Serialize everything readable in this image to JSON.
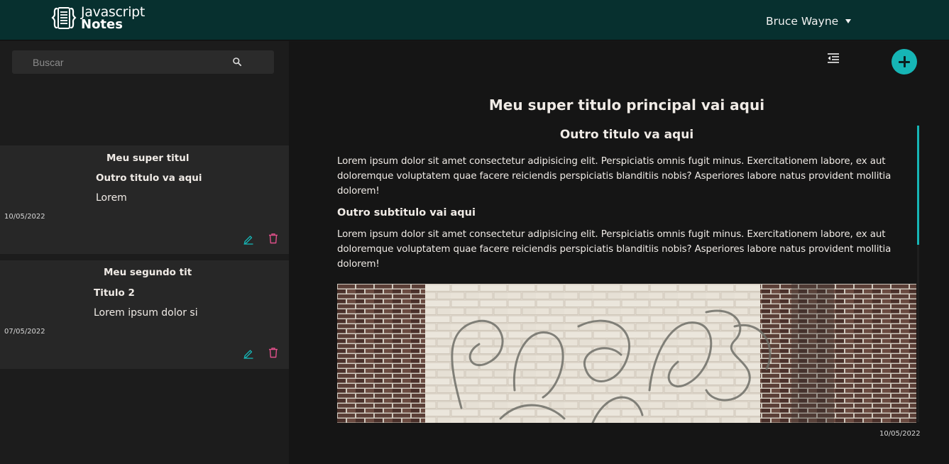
{
  "header": {
    "logo_line1": "Javascript",
    "logo_line2": "Notes",
    "user_name": "Bruce Wayne"
  },
  "search": {
    "placeholder": "Buscar",
    "value": ""
  },
  "notes": [
    {
      "title": "Meu super titul",
      "heading": "Outro titulo va aqui",
      "preview": "Lorem",
      "date": "10/05/2022"
    },
    {
      "title": "Meu segundo tit",
      "heading": "Titulo 2",
      "preview": "Lorem ipsum dolor si",
      "date": "07/05/2022"
    }
  ],
  "document": {
    "title": "Meu super titulo principal vai aqui",
    "heading2": "Outro titulo va aqui",
    "paragraph1": "Lorem ipsum dolor sit amet consectetur adipisicing elit. Perspiciatis omnis fugit minus. Exercitationem labore, ex aut doloremque voluptatem quae facere reiciendis perspiciatis blanditiis nobis? Asperiores labore natus provident mollitia dolorem!",
    "heading3": "Outro subtitulo vai aqui",
    "paragraph2": "Lorem ipsum dolor sit amet consectetur adipisicing elit. Perspiciatis omnis fugit minus. Exercitationem labore, ex aut doloremque voluptatem quae facere reiciendis perspiciatis blanditiis nobis? Asperiores labore natus provident mollitia dolorem!",
    "date": "10/05/2022"
  },
  "icons": {
    "logo": "notebook-braces-icon",
    "user_menu": "caret-down-icon",
    "search": "search-icon",
    "list_toggle": "indent-list-icon",
    "add": "plus-icon",
    "edit": "pencil-icon",
    "delete": "trash-icon"
  },
  "colors": {
    "header_bg": "#07302f",
    "accent": "#16b5b5",
    "edit": "#16b5b5",
    "delete": "#e0508a",
    "card_bg": "#272727"
  }
}
